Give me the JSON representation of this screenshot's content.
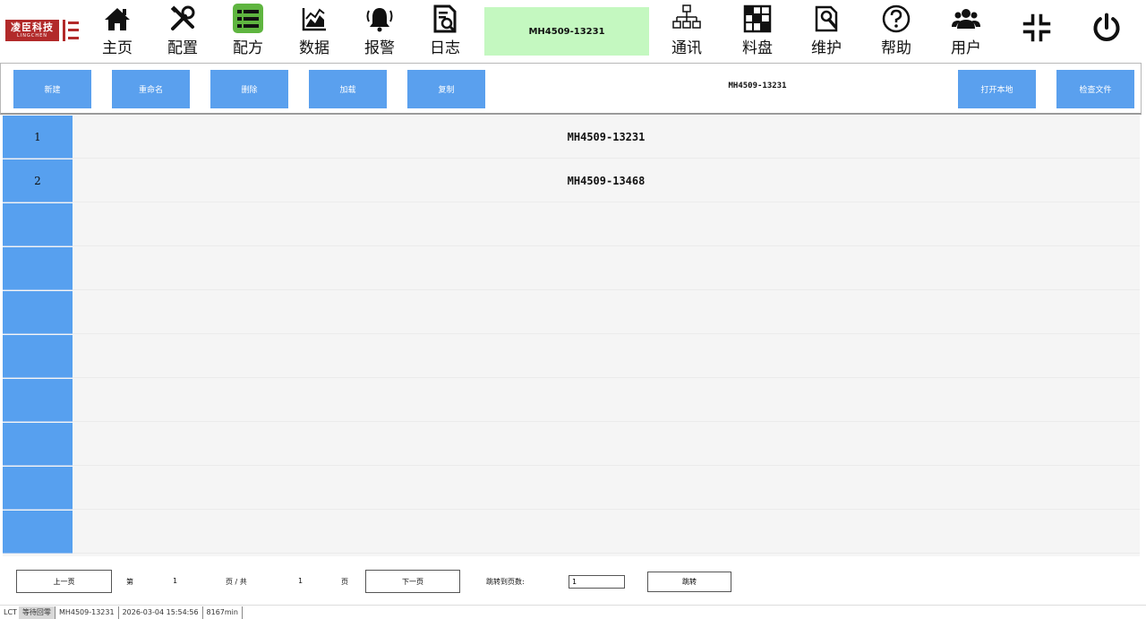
{
  "brand": {
    "name_cn": "凌臣科技",
    "name_en": "LINGCHEN",
    "color": "#b22a2a"
  },
  "nav": {
    "items": [
      {
        "key": "home",
        "label": "主页",
        "icon": "home-icon"
      },
      {
        "key": "config",
        "label": "配置",
        "icon": "tools-icon"
      },
      {
        "key": "recipe",
        "label": "配方",
        "icon": "list-icon",
        "active": true
      },
      {
        "key": "data",
        "label": "数据",
        "icon": "chart-icon"
      },
      {
        "key": "alarm",
        "label": "报警",
        "icon": "bell-icon"
      },
      {
        "key": "log",
        "label": "日志",
        "icon": "log-search-icon"
      },
      {
        "key": "comm",
        "label": "通讯",
        "icon": "network-icon"
      },
      {
        "key": "tray",
        "label": "料盘",
        "icon": "tray-grid-icon"
      },
      {
        "key": "maint",
        "label": "维护",
        "icon": "wrench-icon"
      },
      {
        "key": "help",
        "label": "帮助",
        "icon": "help-icon"
      },
      {
        "key": "user",
        "label": "用户",
        "icon": "users-icon"
      }
    ],
    "current_recipe": "MH4509-13231",
    "active_color": "#5fb540",
    "chip_color": "#c4f8c0"
  },
  "toolbar": {
    "new_label": "新建",
    "rename_label": "重命名",
    "delete_label": "删除",
    "load_label": "加载",
    "copy_label": "复制",
    "current_name": "MH4509-13231",
    "open_local_label": "打开本地",
    "inspect_file_label": "检查文件",
    "button_color": "#5aa0ee"
  },
  "table": {
    "rows": [
      {
        "index": "1",
        "name": "MH4509-13231"
      },
      {
        "index": "2",
        "name": "MH4509-13468"
      },
      {
        "index": "",
        "name": ""
      },
      {
        "index": "",
        "name": ""
      },
      {
        "index": "",
        "name": ""
      },
      {
        "index": "",
        "name": ""
      },
      {
        "index": "",
        "name": ""
      },
      {
        "index": "",
        "name": ""
      },
      {
        "index": "",
        "name": ""
      },
      {
        "index": "",
        "name": ""
      }
    ]
  },
  "pager": {
    "prev_label": "上一页",
    "page_prefix": "第",
    "current_page": "1",
    "page_total_label": "页 / 共",
    "total_pages": "1",
    "page_suffix": "页",
    "next_label": "下一页",
    "jump_label": "跳转到页数:",
    "jump_value": "1",
    "jump_button": "跳转"
  },
  "status": {
    "app": "LCT",
    "state": "等待回零",
    "recipe": "MH4509-13231",
    "datetime": "2026-03-04 15:54:56",
    "runtime": "8167min"
  }
}
